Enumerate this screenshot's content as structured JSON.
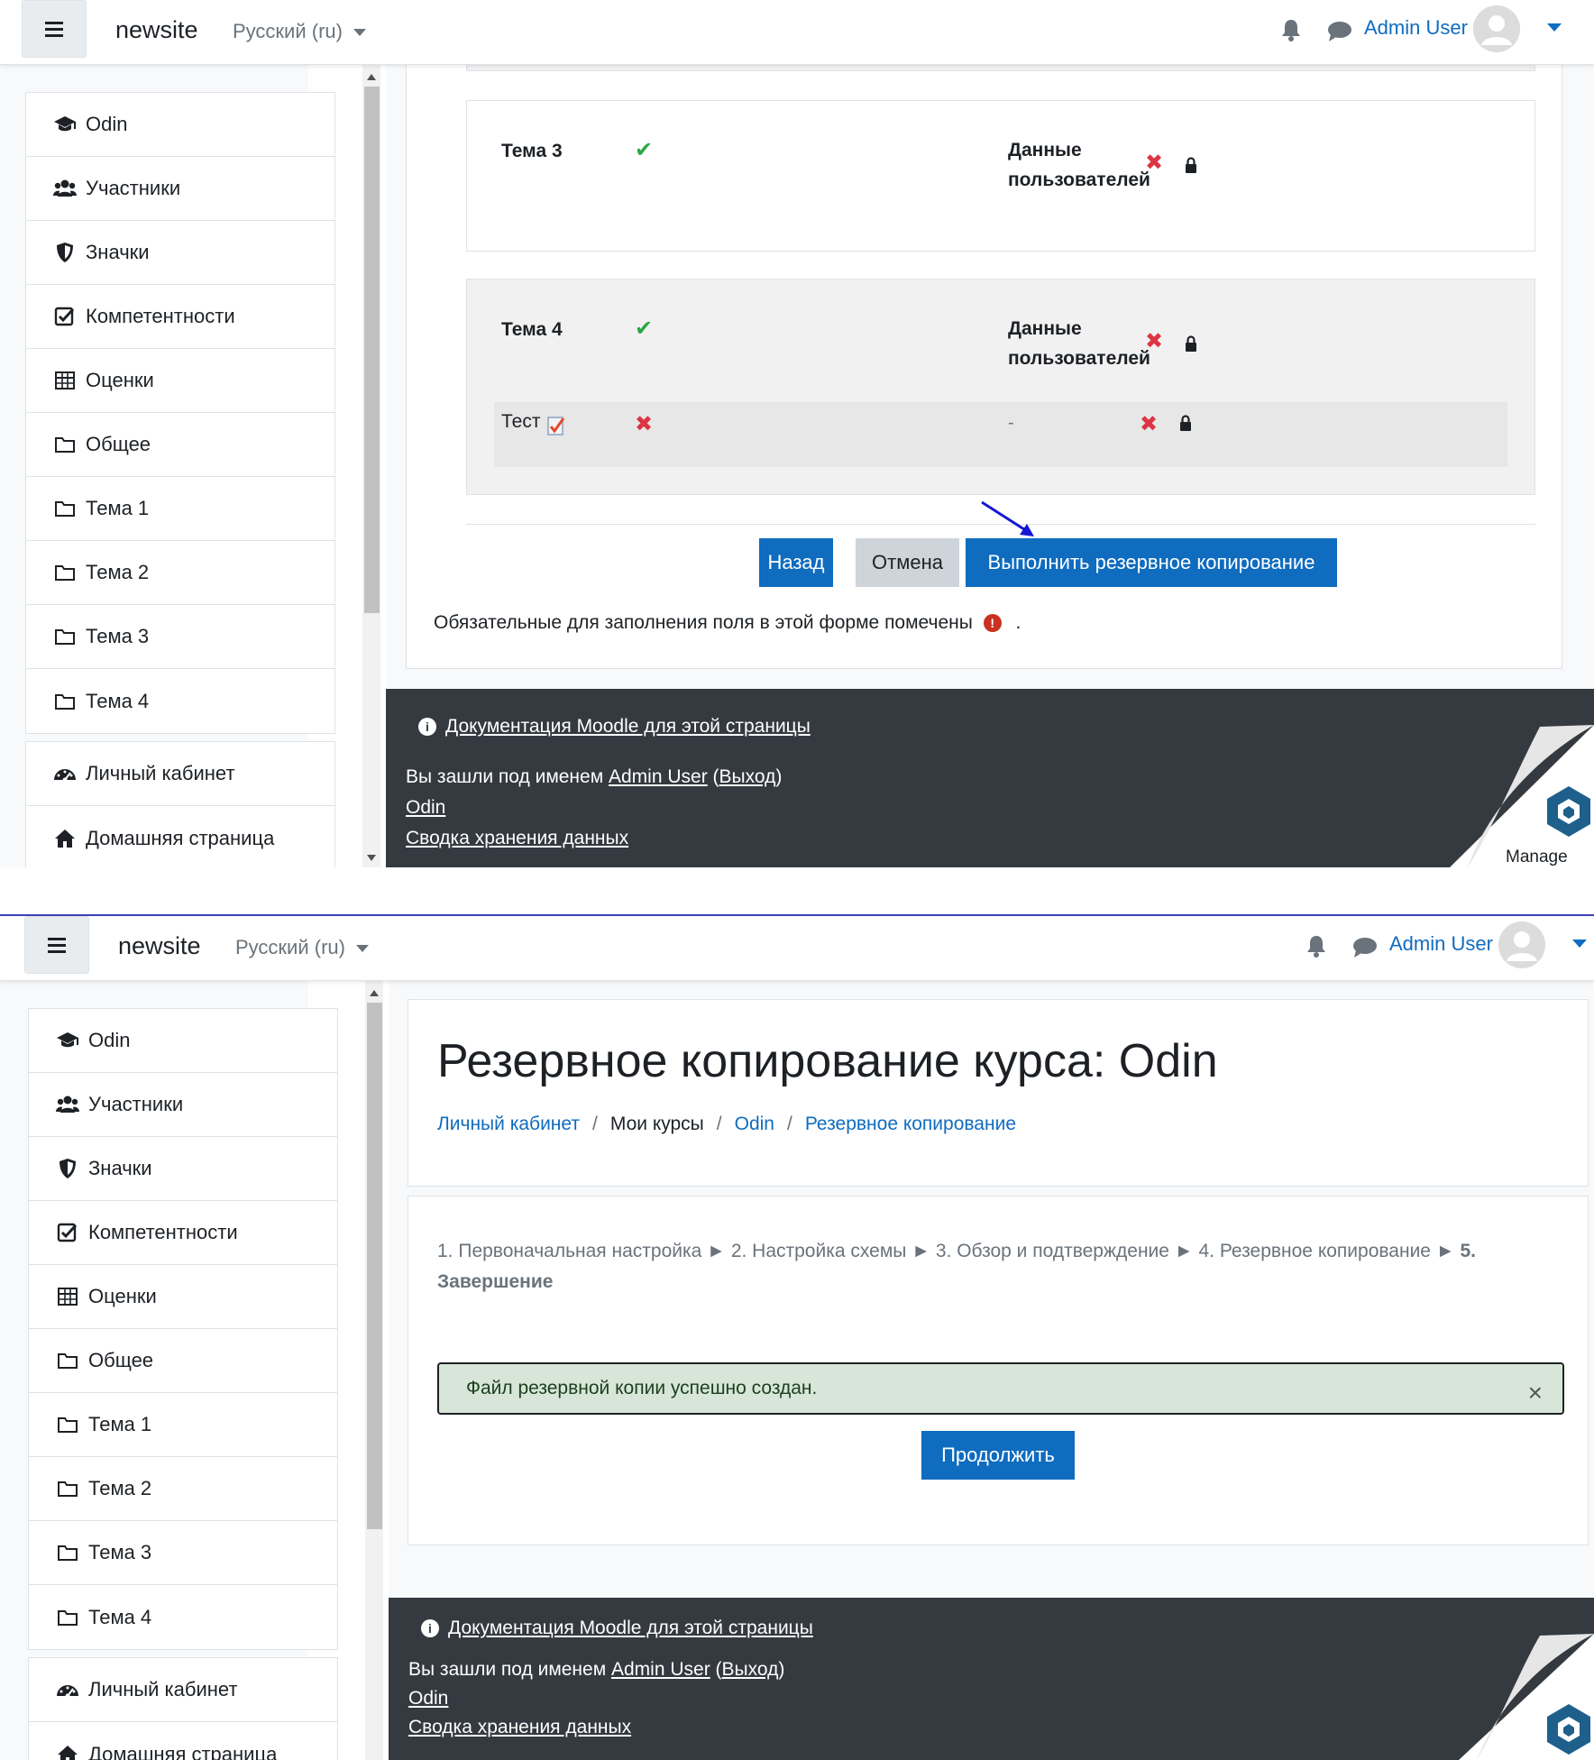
{
  "navbar": {
    "site_name": "newsite",
    "language": "Русский (ru)",
    "user_name": "Admin User"
  },
  "sidebar": {
    "course_items": [
      {
        "label": "Odin",
        "icon": "graduation-cap-icon"
      },
      {
        "label": "Участники",
        "icon": "users-icon"
      },
      {
        "label": "Значки",
        "icon": "shield-icon"
      },
      {
        "label": "Компетентности",
        "icon": "check-square-icon"
      },
      {
        "label": "Оценки",
        "icon": "table-icon"
      },
      {
        "label": "Общее",
        "icon": "folder-icon"
      },
      {
        "label": "Тема 1",
        "icon": "folder-icon"
      },
      {
        "label": "Тема 2",
        "icon": "folder-icon"
      },
      {
        "label": "Тема 3",
        "icon": "folder-icon"
      },
      {
        "label": "Тема 4",
        "icon": "folder-icon"
      }
    ],
    "site_items": [
      {
        "label": "Личный кабинет",
        "icon": "dashboard-icon"
      },
      {
        "label": "Домашняя страница",
        "icon": "home-icon"
      }
    ]
  },
  "review": {
    "sections": [
      {
        "title": "Тема 3",
        "included": true,
        "user_data_label": "Данные пользователей",
        "user_data": false,
        "locked": true
      },
      {
        "title": "Тема 4",
        "included": true,
        "user_data_label": "Данные пользователей",
        "user_data": false,
        "locked": true,
        "activities": [
          {
            "title": "Тест",
            "icon": "quiz-icon",
            "included": false,
            "user_data_label": "-",
            "user_data": false,
            "locked": true
          }
        ]
      }
    ],
    "buttons": {
      "back": "Назад",
      "cancel": "Отмена",
      "perform": "Выполнить резервное копирование"
    },
    "required_note": "Обязательные для заполнения поля в этой форме помечены",
    "required_note_end": "."
  },
  "footer": {
    "docs_link": "Документация Moodle для этой страницы",
    "logged_in_prefix": "Вы зашли под именем",
    "logged_in_user": "Admin User",
    "logout_open": "(",
    "logout": "Выход",
    "logout_close": ")",
    "course_link": "Odin",
    "data_summary": "Сводка хранения данных",
    "manage_label": "Manage"
  },
  "result": {
    "page_title": "Резервное копирование курса: Odin",
    "breadcrumb": [
      "Личный кабинет",
      "Мои курсы",
      "Odin",
      "Резервное копирование"
    ],
    "breadcrumb_sep": "/",
    "steps": [
      "1. Первоначальная настройка",
      "2. Настройка схемы",
      "3. Обзор и подтверждение",
      "4. Резервное копирование",
      "5. Завершение"
    ],
    "step_arrow": "►",
    "success_message": "Файл резервной копии успешно создан.",
    "close_glyph": "×",
    "continue_button": "Продолжить"
  },
  "colors": {
    "primary": "#0f6cbf",
    "footer_bg": "#343a40",
    "success_bg": "#d7e6d8",
    "check_green": "#28a745",
    "cross_red": "#dc3545",
    "annotation_arrow": "#1515d6"
  }
}
